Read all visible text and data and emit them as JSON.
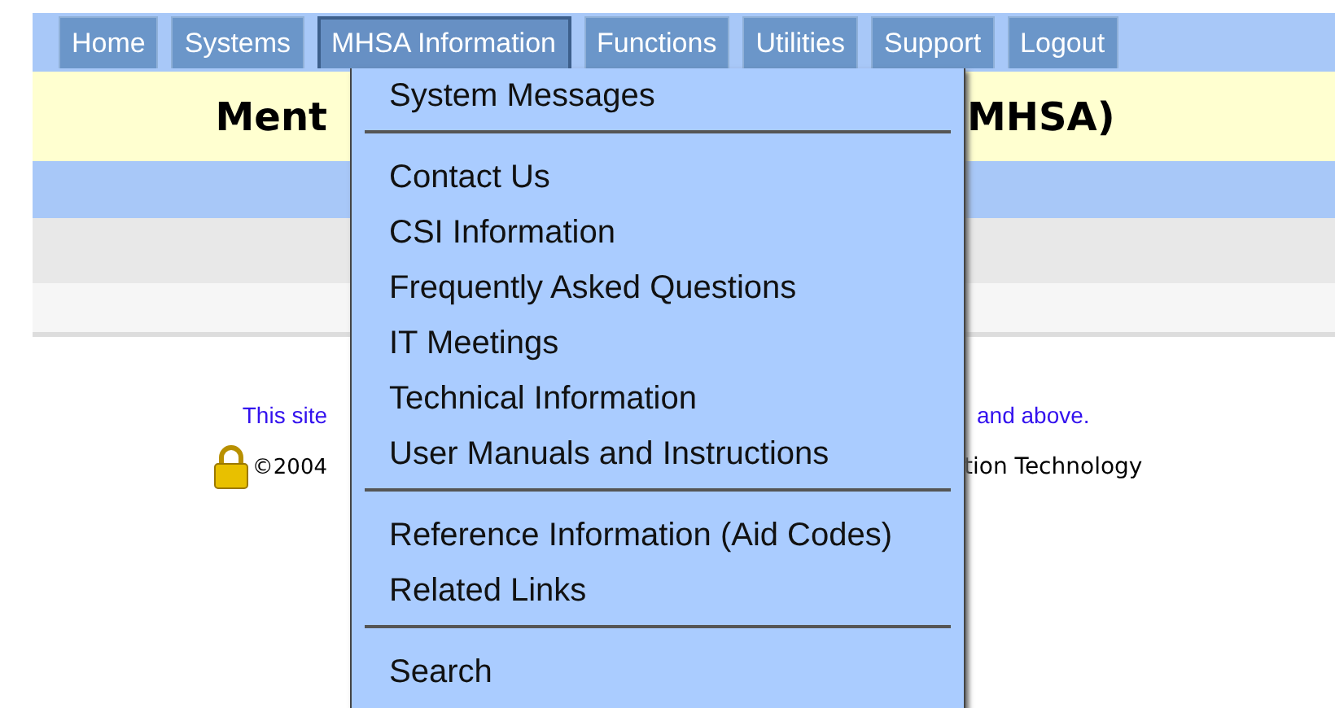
{
  "nav": [
    {
      "label": "Home",
      "selected": false
    },
    {
      "label": "Systems",
      "selected": false
    },
    {
      "label": "MHSA Information",
      "selected": true
    },
    {
      "label": "Functions",
      "selected": false
    },
    {
      "label": "Utilities",
      "selected": false
    },
    {
      "label": "Support",
      "selected": false
    },
    {
      "label": "Logout",
      "selected": false
    }
  ],
  "banner": {
    "title_left": "Ment",
    "title_right": "MHSA)"
  },
  "footer": {
    "line1_left": "This site",
    "line1_right": "and above.",
    "line2_left": "©2004",
    "line2_right": "tion Technology"
  },
  "menu": {
    "groups": [
      [
        "System Messages"
      ],
      [
        "Contact Us",
        "CSI Information",
        "Frequently Asked Questions",
        "IT Meetings",
        "Technical Information",
        "User Manuals and Instructions"
      ],
      [
        "Reference Information (Aid Codes)",
        "Related Links"
      ],
      [
        "Search"
      ]
    ]
  }
}
